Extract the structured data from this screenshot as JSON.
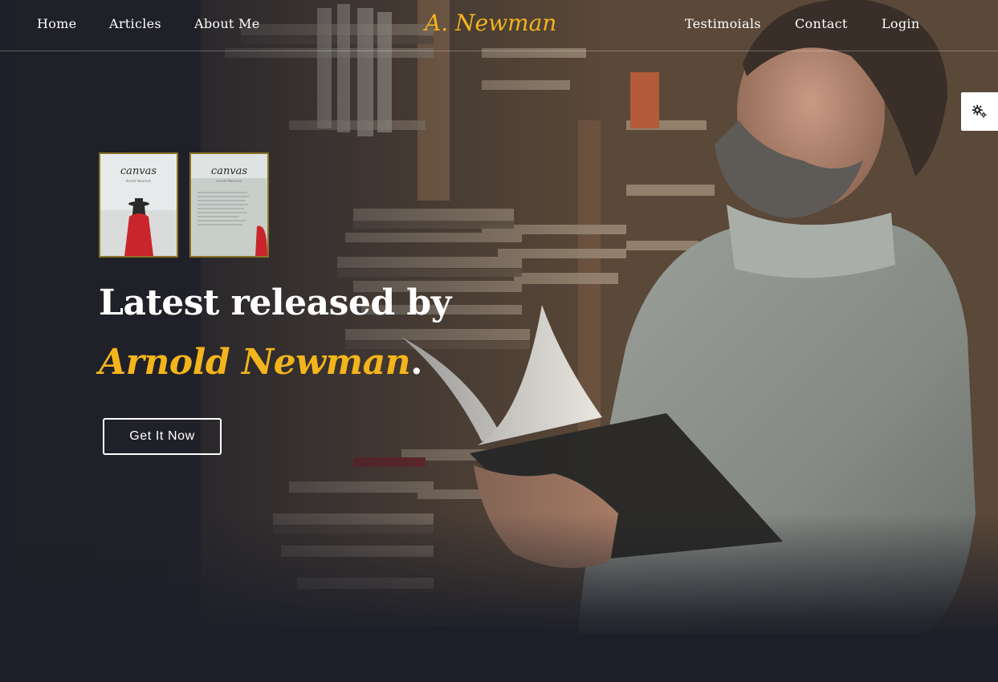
{
  "nav": {
    "left": [
      {
        "label": "Home"
      },
      {
        "label": "Articles"
      },
      {
        "label": "About Me"
      }
    ],
    "brand": "A. Newman",
    "right": [
      {
        "label": "Testimoials"
      },
      {
        "label": "Contact"
      },
      {
        "label": "Login"
      }
    ]
  },
  "covers": [
    {
      "title": "canvas",
      "subtitle": "Arnold Newman"
    },
    {
      "title": "canvas",
      "subtitle": "Arnold Newman"
    }
  ],
  "hero": {
    "headline": "Latest released by",
    "author": "Arnold Newman",
    "author_suffix": ".",
    "cta_label": "Get It Now"
  },
  "settings": {
    "icon": "gears-icon"
  },
  "colors": {
    "accent": "#f3b41c",
    "background": "#1e2029",
    "text": "#ffffff"
  }
}
